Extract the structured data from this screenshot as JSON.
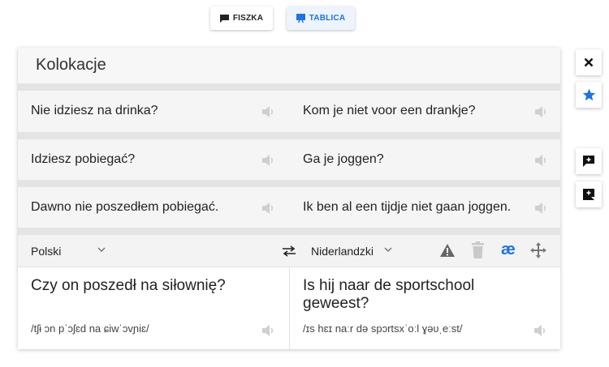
{
  "top_tabs": {
    "fiszka": "FISZKA",
    "tablica": "TABLICA"
  },
  "card": {
    "title": "Kolokacje"
  },
  "rows": [
    {
      "src": "Nie idziesz na drinka?",
      "dst": "Kom je niet voor een drankje?"
    },
    {
      "src": "Idziesz pobiegać?",
      "dst": "Ga je joggen?"
    },
    {
      "src": "Dawno nie poszedłem pobiegać.",
      "dst": "Ik ben al een tijdje niet gaan joggen."
    }
  ],
  "toolbar": {
    "source_language": "Polski",
    "target_language": "Niderlandzki",
    "ae_glyph": "æ"
  },
  "editor": {
    "source_text": "Czy on poszedł na siłownię?",
    "source_ipa": "/tʃɨ ɔn pˈɔʃɛd na ɕiwˈɔvɲiɛ/",
    "target_text": "Is hij naar de sportschool geweest?",
    "target_ipa": "/ɪs hɛɪ naːr də spɔrtsxˈoːl ɣəʋˌeːst/"
  },
  "colors": {
    "accent": "#1a73e8",
    "icon_gray": "#c8c8c8"
  },
  "icons": {
    "tab_fiszka": "card-icon",
    "tab_tablica": "board-icon",
    "swap": "swap-arrows-icon",
    "warning": "warning-icon",
    "trash": "trash-icon",
    "move": "move-arrows-icon",
    "close": "close-icon",
    "star": "star-icon",
    "add_comment": "add-comment-icon",
    "speaker": "speaker-icon"
  }
}
